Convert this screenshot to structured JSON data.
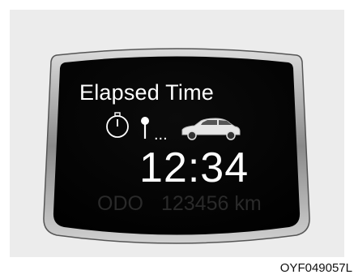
{
  "display": {
    "title": "Elapsed Time",
    "time": "12:34",
    "odometer_label": "ODO",
    "odometer_value": "123456 km",
    "icons": [
      "stopwatch-icon",
      "destination-pin-icon",
      "car-icon"
    ],
    "dots": "..."
  },
  "caption": "OYF049057L"
}
